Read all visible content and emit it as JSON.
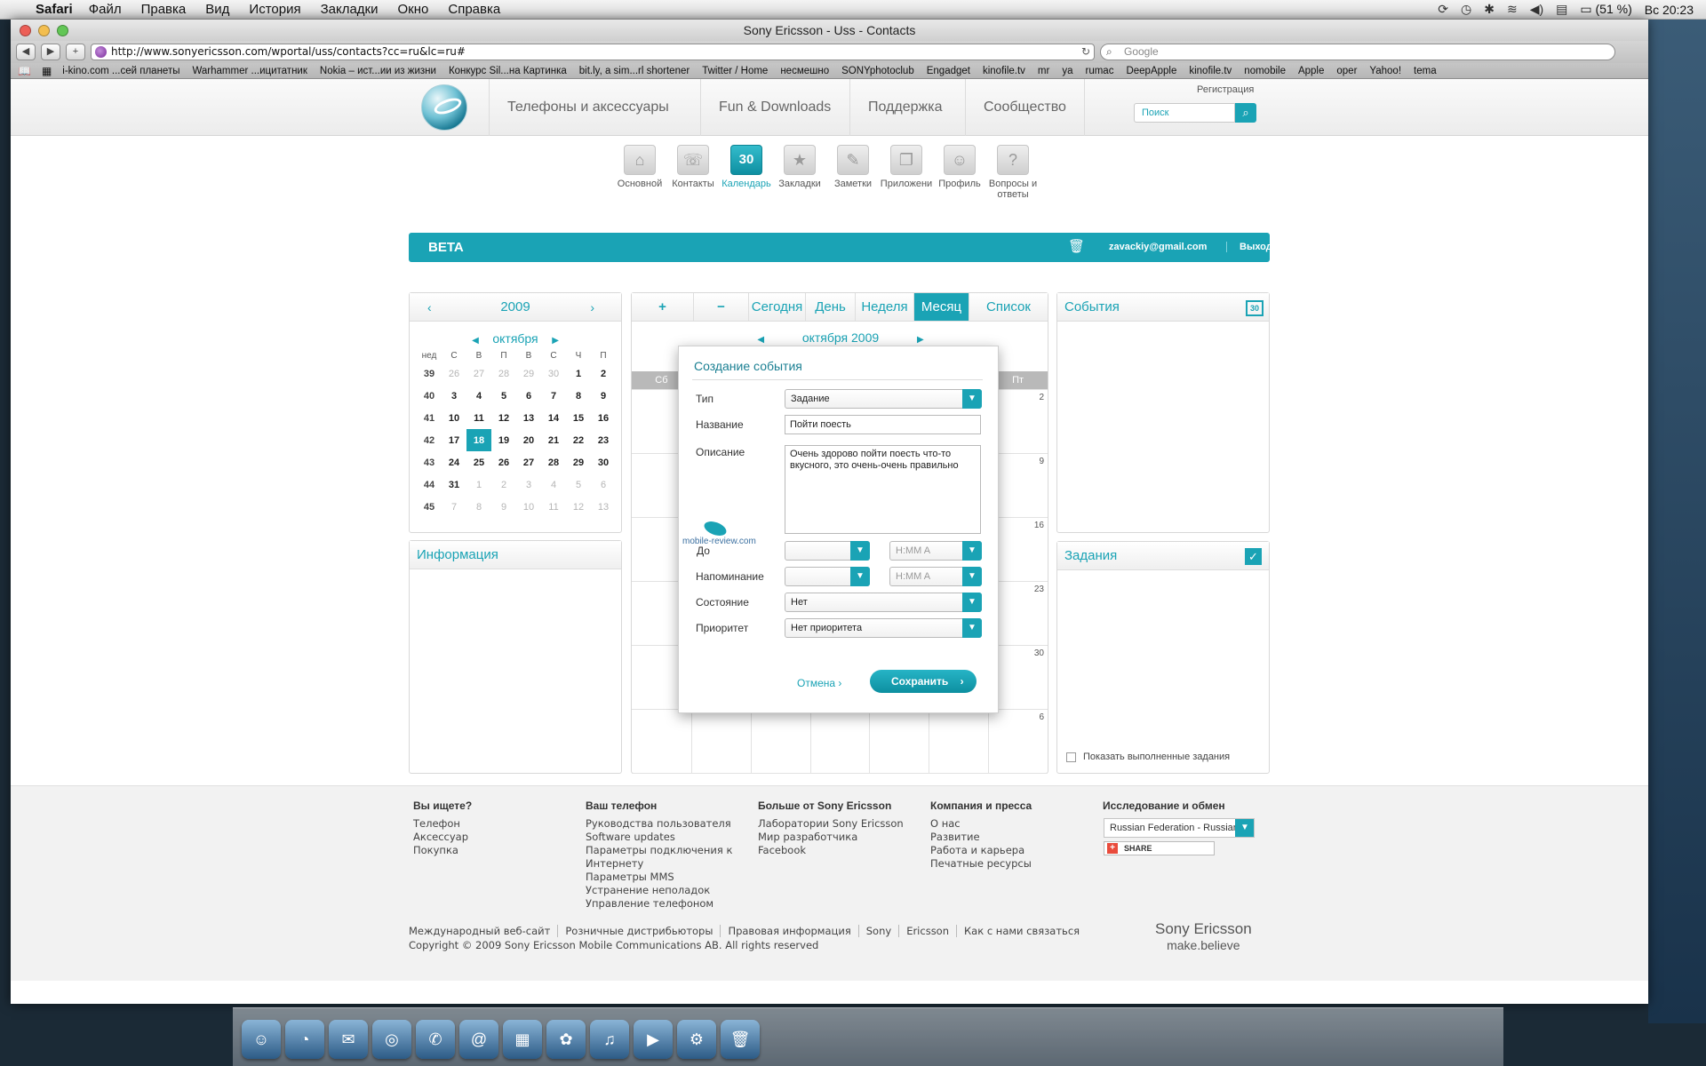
{
  "menubar": {
    "app": "Safari",
    "menus": [
      "Файл",
      "Правка",
      "Вид",
      "История",
      "Закладки",
      "Окно",
      "Справка"
    ],
    "battery": "(51 %)",
    "clock": "Вс 20:23"
  },
  "window": {
    "title": "Sony Ericsson - Uss - Contacts",
    "url": "http://www.sonyericsson.com/wportal/uss/contacts?cc=ru&lc=ru#",
    "search_placeholder": "Google"
  },
  "bookmarks": [
    "i-kino.com ...сей планеты",
    "Warhammer ...ицитатник",
    "Nokia – ист...ии из жизни",
    "Конкурс Sil...на Картинка",
    "bit.ly, a sim...rl shortener",
    "Twitter / Home",
    "несмешно",
    "SONYphotoclub",
    "Engadget",
    "kinofile.tv",
    "mr",
    "ya",
    "rumac",
    "DeepApple",
    "kinofile.tv",
    "nomobile",
    "Apple",
    "oper",
    "Yahoo!",
    "tema"
  ],
  "site": {
    "nav": [
      "Телефоны и аксессуары",
      "Fun & Downloads",
      "Поддержка",
      "Сообщество"
    ],
    "register": "Регистрация",
    "search_placeholder": "Поиск",
    "apps": [
      {
        "label": "Основной",
        "icon": "home-icon"
      },
      {
        "label": "Контакты",
        "icon": "contacts-icon"
      },
      {
        "label": "Календарь",
        "icon": "calendar-icon",
        "glyph": "30"
      },
      {
        "label": "Закладки",
        "icon": "star-icon"
      },
      {
        "label": "Заметки",
        "icon": "notes-icon"
      },
      {
        "label": "Приложени",
        "icon": "apps-icon"
      },
      {
        "label": "Профиль",
        "icon": "profile-icon"
      },
      {
        "label": "Вопросы и ответы",
        "icon": "help-icon"
      }
    ],
    "beta": "BETA",
    "email": "zavackiy@gmail.com",
    "logout": "Выход"
  },
  "mini_calendar": {
    "year": "2009",
    "month": "октября",
    "weekday_headers": [
      "нед",
      "С",
      "В",
      "П",
      "В",
      "С",
      "Ч",
      "П"
    ],
    "rows": [
      [
        "39",
        "26",
        "27",
        "28",
        "29",
        "30",
        "1",
        "2"
      ],
      [
        "40",
        "3",
        "4",
        "5",
        "6",
        "7",
        "8",
        "9"
      ],
      [
        "41",
        "10",
        "11",
        "12",
        "13",
        "14",
        "15",
        "16"
      ],
      [
        "42",
        "17",
        "18",
        "19",
        "20",
        "21",
        "22",
        "23"
      ],
      [
        "43",
        "24",
        "25",
        "26",
        "27",
        "28",
        "29",
        "30"
      ],
      [
        "44",
        "31",
        "1",
        "2",
        "3",
        "4",
        "5",
        "6"
      ],
      [
        "45",
        "7",
        "8",
        "9",
        "10",
        "11",
        "12",
        "13"
      ]
    ],
    "today": "18"
  },
  "info_panel": {
    "title": "Информация"
  },
  "main_calendar": {
    "toolbar": [
      "+",
      "−",
      "Сегодня",
      "День",
      "Неделя",
      "Месяц",
      "Список"
    ],
    "active_view": "Месяц",
    "month_title": "октября 2009",
    "weekday_headers": [
      "Сб",
      "",
      "",
      "",
      "",
      "",
      "Пт"
    ],
    "date_numbers": [
      "2",
      "9",
      "16",
      "23",
      "30",
      "6"
    ]
  },
  "events_panel": {
    "title": "События",
    "icon_text": "30"
  },
  "tasks_panel": {
    "title": "Задания",
    "show_completed": "Показать выполненные задания"
  },
  "modal": {
    "title": "Создание события",
    "type_label": "Тип",
    "type_value": "Задание",
    "name_label": "Название",
    "name_value": "Пойти поесть",
    "desc_label": "Описание",
    "desc_value": "Очень здорово пойти поесть что-то вкусного, это очень-очень правильно",
    "due_label": "До",
    "time_placeholder": "H:MM A",
    "reminder_label": "Напоминание",
    "status_label": "Состояние",
    "status_value": "Нет",
    "priority_label": "Приоритет",
    "priority_value": "Нет приоритета",
    "cancel": "Отмена",
    "save": "Сохранить",
    "watermark": "mobile-review.com"
  },
  "footer": {
    "columns": [
      {
        "title": "Вы ищете?",
        "links": [
          "Телефон",
          "Аксессуар",
          "Покупка"
        ]
      },
      {
        "title": "Ваш телефон",
        "links": [
          "Руководства пользователя",
          "Software updates",
          "Параметры подключения к Интернету",
          "Параметры MMS",
          "Устранение неполадок",
          "Управление телефоном"
        ]
      },
      {
        "title": "Больше от Sony Ericsson",
        "links": [
          "Лаборатории Sony Ericsson",
          "Мир разработчика",
          "Facebook"
        ]
      },
      {
        "title": "Компания и пресса",
        "links": [
          "О нас",
          "Развитие",
          "Работа и карьера",
          "Печатные ресурсы"
        ]
      },
      {
        "title": "Исследование и обмен",
        "links": []
      }
    ],
    "country": "Russian Federation - Russian",
    "share": "SHARE",
    "legal": [
      "Международный веб-сайт",
      "Розничные дистрибьюторы",
      "Правовая информация",
      "Sony",
      "Ericsson",
      "Как с нами связаться"
    ],
    "copyright": "Copyright © 2009 Sony Ericsson Mobile Communications AB. All rights reserved",
    "brand": "Sony Ericsson",
    "slogan": "make.believe"
  },
  "dock": [
    "finder-icon",
    "dashboard-icon",
    "mail-icon",
    "safari-icon",
    "ichat-icon",
    "addressbook-icon",
    "ical-icon",
    "iphoto-icon",
    "itunes-icon",
    "imovie-icon",
    "preferences-icon",
    "trash-icon"
  ],
  "colors": {
    "accent": "#1aa3b5"
  }
}
